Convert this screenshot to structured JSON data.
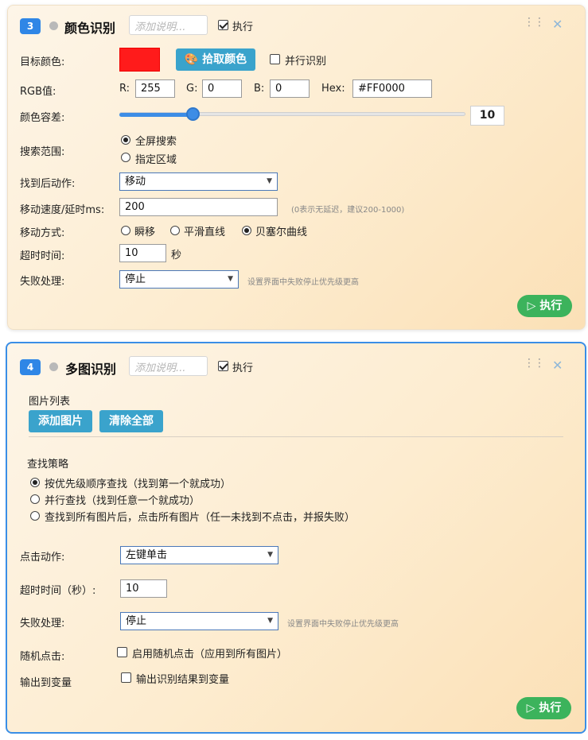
{
  "card1": {
    "index": "3",
    "title": "颜色识别",
    "desc_placeholder": "添加说明...",
    "execute_label": "执行",
    "target_color_label": "目标颜色:",
    "target_color": "#FF1B1B",
    "pick_color_label": "拾取颜色",
    "parallel_label": "并行识别",
    "rgb_label": "RGB值:",
    "r_label": "R:",
    "r_value": "255",
    "g_label": "G:",
    "g_value": "0",
    "b_label": "B:",
    "b_value": "0",
    "hex_label": "Hex:",
    "hex_value": "#FF0000",
    "tolerance_label": "颜色容差:",
    "tolerance_value": "10",
    "search_range_label": "搜索范围:",
    "search_fullscreen": "全屏搜索",
    "search_region": "指定区域",
    "after_found_label": "找到后动作:",
    "after_found_value": "移动",
    "move_speed_label": "移动速度/延时ms:",
    "move_speed_value": "200",
    "move_speed_hint": "(0表示无延迟，建议200-1000)",
    "move_mode_label": "移动方式:",
    "move_instant": "瞬移",
    "move_line": "平滑直线",
    "move_bezier": "贝塞尔曲线",
    "timeout_label": "超时时间:",
    "timeout_value": "10",
    "timeout_unit": "秒",
    "fail_label": "失败处理:",
    "fail_value": "停止",
    "fail_hint": "设置界面中失败停止优先级更高",
    "run_label": "执行"
  },
  "card2": {
    "index": "4",
    "title": "多图识别",
    "desc_placeholder": "添加说明...",
    "execute_label": "执行",
    "image_list_label": "图片列表",
    "add_image_label": "添加图片",
    "clear_all_label": "清除全部",
    "strategy_label": "查找策略",
    "strategy_priority": "按优先级顺序查找（找到第一个就成功）",
    "strategy_parallel": "并行查找（找到任意一个就成功）",
    "strategy_all": "查找到所有图片后，点击所有图片（任一未找到不点击，并报失败）",
    "click_action_label": "点击动作:",
    "click_action_value": "左键单击",
    "timeout_label": "超时时间（秒）:",
    "timeout_value": "10",
    "fail_label": "失败处理:",
    "fail_value": "停止",
    "fail_hint": "设置界面中失败停止优先级更高",
    "random_click_label": "随机点击:",
    "random_click_option": "启用随机点击（应用到所有图片）",
    "output_var_label": "输出到变量",
    "output_var_option": "输出识别结果到变量",
    "run_label": "执行"
  },
  "colors": {
    "accent": "#2F86E6",
    "run_green": "#3CB35C",
    "button_blue": "#3AA3CC",
    "selected_border": "#3A8EE6"
  }
}
